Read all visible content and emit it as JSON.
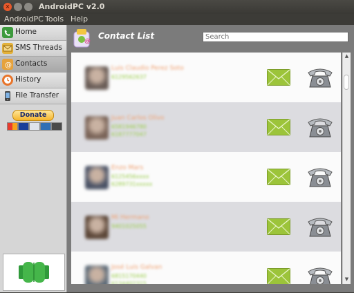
{
  "window": {
    "title": "AndroidPC v2.0"
  },
  "menu": [
    "AndroidPC",
    "Tools",
    "Help"
  ],
  "sidebar": {
    "items": [
      {
        "label": "Home",
        "icon": "home-phone-icon",
        "color": "#3e9a3e"
      },
      {
        "label": "SMS Threads",
        "icon": "envelope-icon",
        "color": "#e3b13a"
      },
      {
        "label": "Contacts",
        "icon": "contacts-icon",
        "color": "#e6a23c"
      },
      {
        "label": "History",
        "icon": "clock-icon",
        "color": "#e8742a"
      },
      {
        "label": "File Transfer",
        "icon": "phone-transfer-icon",
        "color": "#555555"
      }
    ],
    "active_index": 2,
    "donate_label": "Donate"
  },
  "main": {
    "title": "Contact List",
    "search_placeholder": "Search"
  },
  "contacts": [
    {
      "name": "Luis Claudio Perez Soto",
      "numbers": [
        "6129562637"
      ],
      "avatar_color": "#6a5d57"
    },
    {
      "name": "Juan Carlos Olivo",
      "numbers": [
        "6581946780",
        "6187777047"
      ],
      "avatar_color": "#7a6458"
    },
    {
      "name": "Enzo Mars",
      "numbers": [
        "6125456xxxx",
        "6289731xxxxx"
      ],
      "avatar_color": "#4b5366"
    },
    {
      "name": "Mi Hermano",
      "numbers": [
        "9401025055"
      ],
      "avatar_color": "#5c4738"
    },
    {
      "name": "José Luis Galvan",
      "numbers": [
        "6815170440",
        "6134402315"
      ],
      "avatar_color": "#5d6b78"
    }
  ],
  "colors": {
    "sms": "#9cc43a",
    "phone": "#8a8e94",
    "accent_orange": "#f0a070",
    "accent_green": "#9acd4a"
  }
}
